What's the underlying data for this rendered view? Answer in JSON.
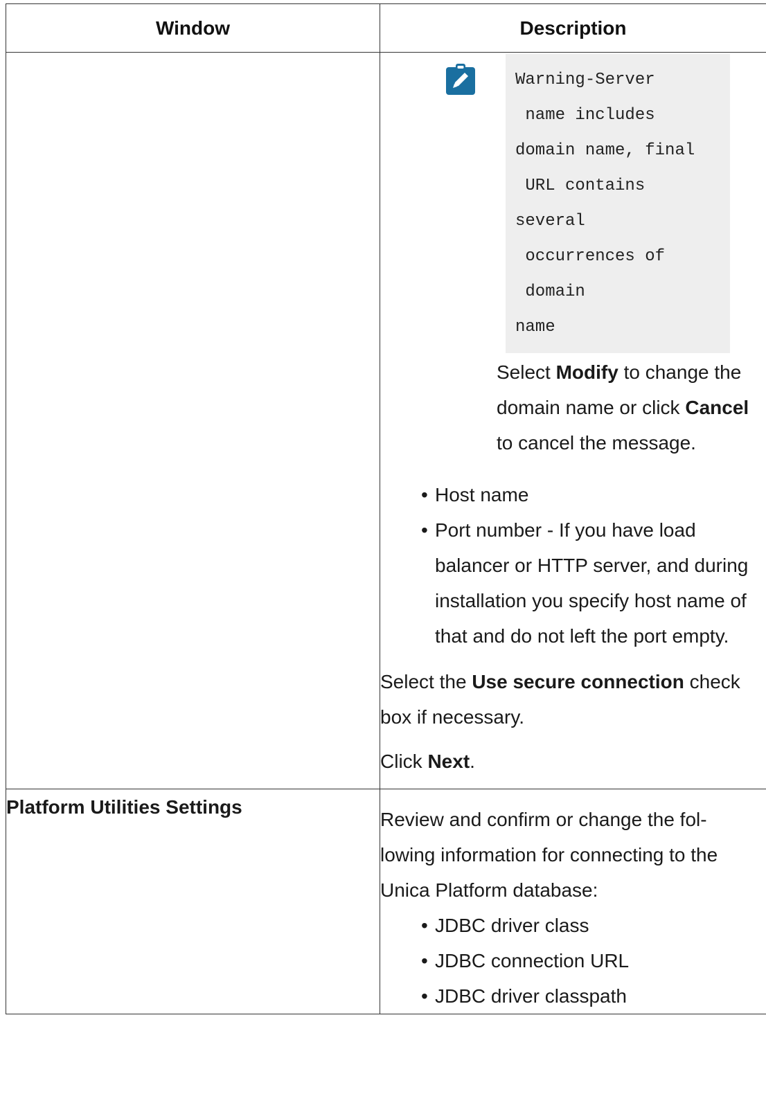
{
  "table": {
    "header": {
      "window": "Window",
      "description": "Description"
    },
    "row1": {
      "window": "",
      "note": {
        "icon": "note-pencil-icon",
        "icon_color": "#1a6fa0",
        "code_lines": [
          "Warning-Server",
          " name includes",
          "domain name, final",
          " URL contains",
          "several",
          " occurrences of",
          " domain",
          "name"
        ]
      },
      "modify_para": {
        "p1": "Select ",
        "b1": "Modify",
        "p2": " to change the domain name or click ",
        "b2": "Cancel",
        "p3": " to cancel the message."
      },
      "bullets": [
        "Host name",
        "Port number - If you have load balancer or HTTP server, and during installation you specify host name of that and do not left the port empty."
      ],
      "secure_para": {
        "p1": "Select the ",
        "b1": "Use secure connection",
        "p2": " check box if necessary."
      },
      "next_para": {
        "p1": "Click ",
        "b1": "Next",
        "p2": "."
      }
    },
    "row2": {
      "window": "Platform Utilities Settings",
      "intro": "Review and confirm or change the fol-lowing information for connecting to the Unica Platform database:",
      "bullets": [
        "JDBC driver class",
        "JDBC connection URL",
        "JDBC driver classpath"
      ]
    }
  }
}
